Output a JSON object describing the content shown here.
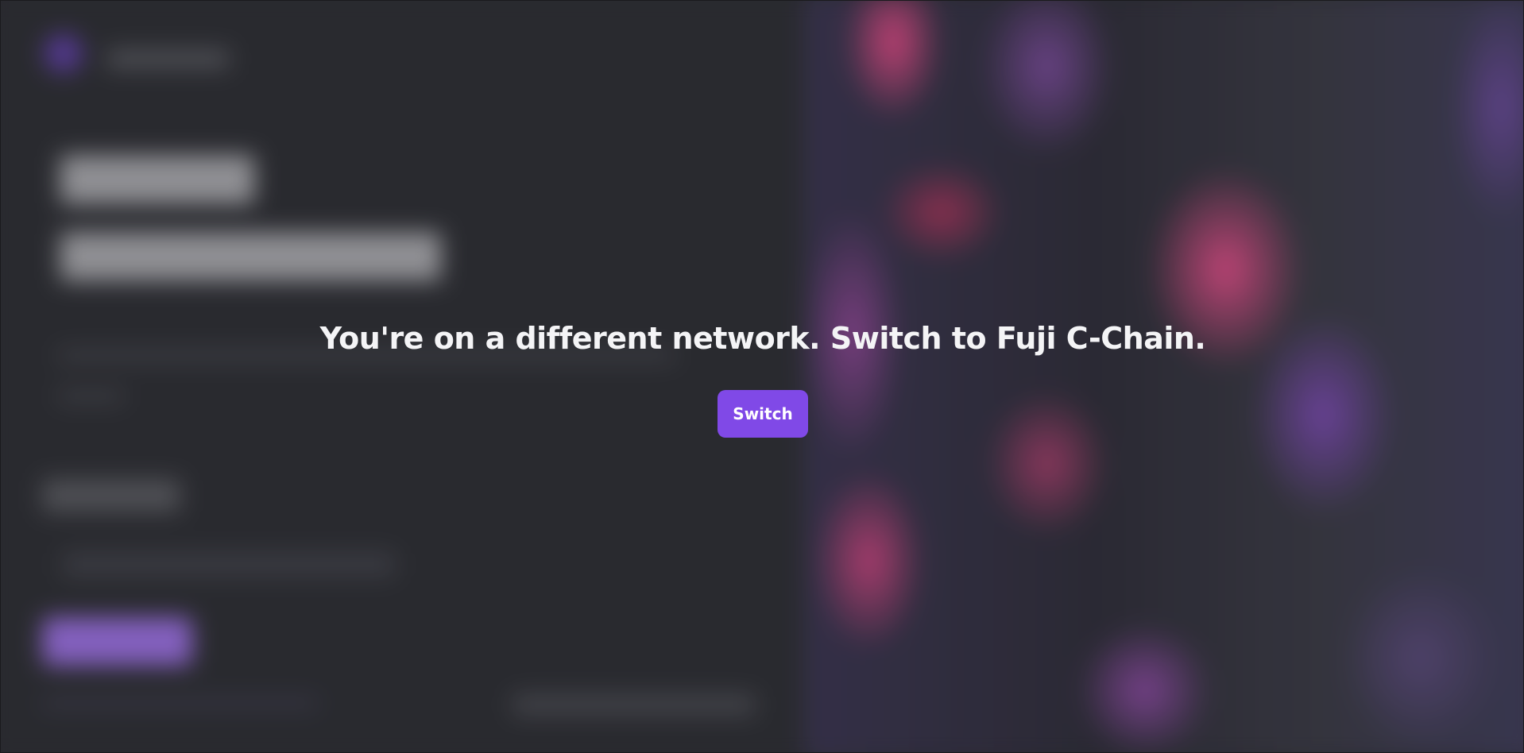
{
  "dialog": {
    "message": "You're on a different network. Switch to Fuji C-Chain.",
    "switch_label": "Switch"
  },
  "colors": {
    "accent": "#8049e7",
    "background": "#2b2c31",
    "text": "#f4f4f6"
  }
}
